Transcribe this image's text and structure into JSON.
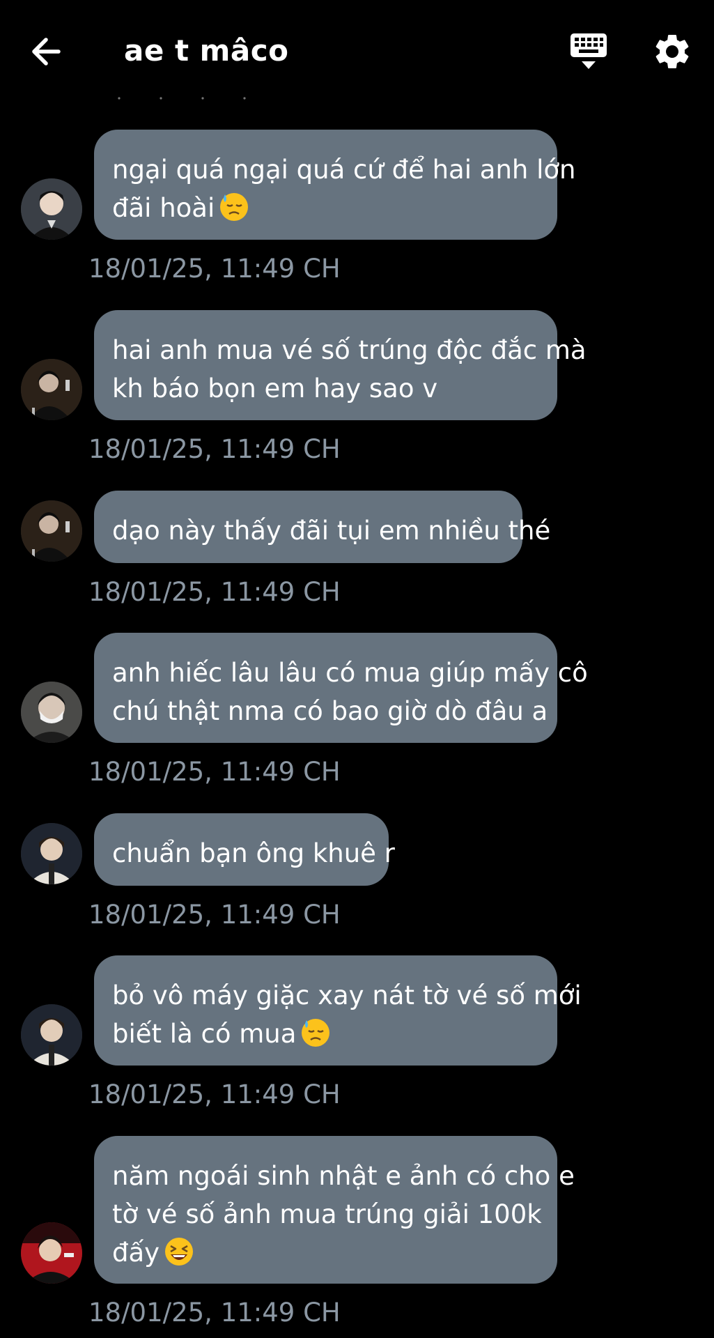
{
  "header": {
    "title": "ae t mâco",
    "back_icon": "arrow-left-icon",
    "keyboard_icon": "keyboard-hide-icon",
    "settings_icon": "gear-icon"
  },
  "colors": {
    "background": "#000000",
    "bubble": "#66737f",
    "timestamp": "#8b97a3",
    "text": "#ffffff"
  },
  "messages": [
    {
      "lines": [
        "ngại quá ngại quá cứ để hai anh lớn",
        "đãi hoài"
      ],
      "emoji": "downcast-sweat-emoji",
      "time": "18/01/25, 11:49 CH",
      "avatar": "avatar-1"
    },
    {
      "lines": [
        "hai anh mua vé số trúng độc đắc mà",
        "kh báo bọn em hay sao v"
      ],
      "emoji": "",
      "time": "18/01/25, 11:49 CH",
      "avatar": "avatar-2"
    },
    {
      "lines": [
        "dạo này thấy đãi tụi em nhiều thé"
      ],
      "emoji": "",
      "time": "18/01/25, 11:49 CH",
      "avatar": "avatar-2"
    },
    {
      "lines": [
        "anh hiếc lâu lâu có mua giúp mấy cô",
        "chú thật nma có bao giờ dò đâu a"
      ],
      "emoji": "",
      "time": "18/01/25, 11:49 CH",
      "avatar": "avatar-3"
    },
    {
      "lines": [
        "chuẩn bạn ông khuê r"
      ],
      "emoji": "",
      "time": "18/01/25, 11:49 CH",
      "avatar": "avatar-4"
    },
    {
      "lines": [
        "bỏ vô máy giặc xay nát tờ vé số mới",
        "biết là có mua"
      ],
      "emoji": "downcast-sweat-emoji",
      "time": "18/01/25, 11:49 CH",
      "avatar": "avatar-4"
    },
    {
      "lines": [
        "năm ngoái sinh nhật e ảnh có cho e",
        "tờ vé số ảnh mua trúng giải 100k",
        "đấy"
      ],
      "emoji": "grinning-squint-emoji",
      "time": "18/01/25, 11:49 CH",
      "avatar": "avatar-5"
    }
  ]
}
